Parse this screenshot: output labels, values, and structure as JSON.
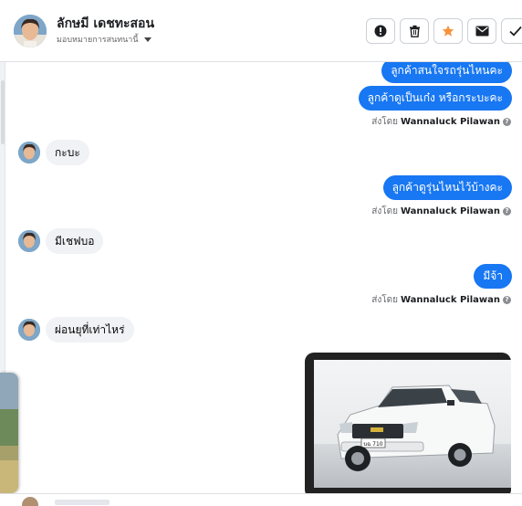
{
  "header": {
    "contact_name": "ลักษมี เดชทะสอน",
    "assign_label": "มอบหมายการสนทนานี้",
    "actions": [
      {
        "name": "mark-spam-button",
        "icon": "exclamation-icon"
      },
      {
        "name": "delete-button",
        "icon": "trash-icon"
      },
      {
        "name": "star-button",
        "icon": "star-icon"
      },
      {
        "name": "mark-unread-button",
        "icon": "envelope-icon"
      },
      {
        "name": "mark-done-button",
        "icon": "checkmark-icon"
      }
    ]
  },
  "messages": [
    {
      "direction": "out",
      "text": "ลูกค้าสนใจรถรุ่นไหนคะ"
    },
    {
      "direction": "out",
      "text": "ลูกค้าดูเป็นเก๋ง หรือกระบะคะ"
    },
    {
      "direction": "in",
      "text": "กะบะ"
    },
    {
      "direction": "out",
      "text": "ลูกค้าดูรุ่นไหนไว้บ้างคะ"
    },
    {
      "direction": "in",
      "text": "มีเชฟบอ"
    },
    {
      "direction": "out",
      "text": "มีจ้า"
    },
    {
      "direction": "in",
      "text": "ผ่อนยุที่เท่าไหร่"
    }
  ],
  "sent_by": {
    "prefix": "ส่งโดย",
    "author": "Wannaluck Pilawan"
  },
  "attachment": {
    "kind": "photo",
    "plate_text": "บฉ 710"
  },
  "colors": {
    "outgoing_bubble": "#1877f2",
    "incoming_bubble": "#f0f2f5",
    "star": "#f7923a"
  }
}
